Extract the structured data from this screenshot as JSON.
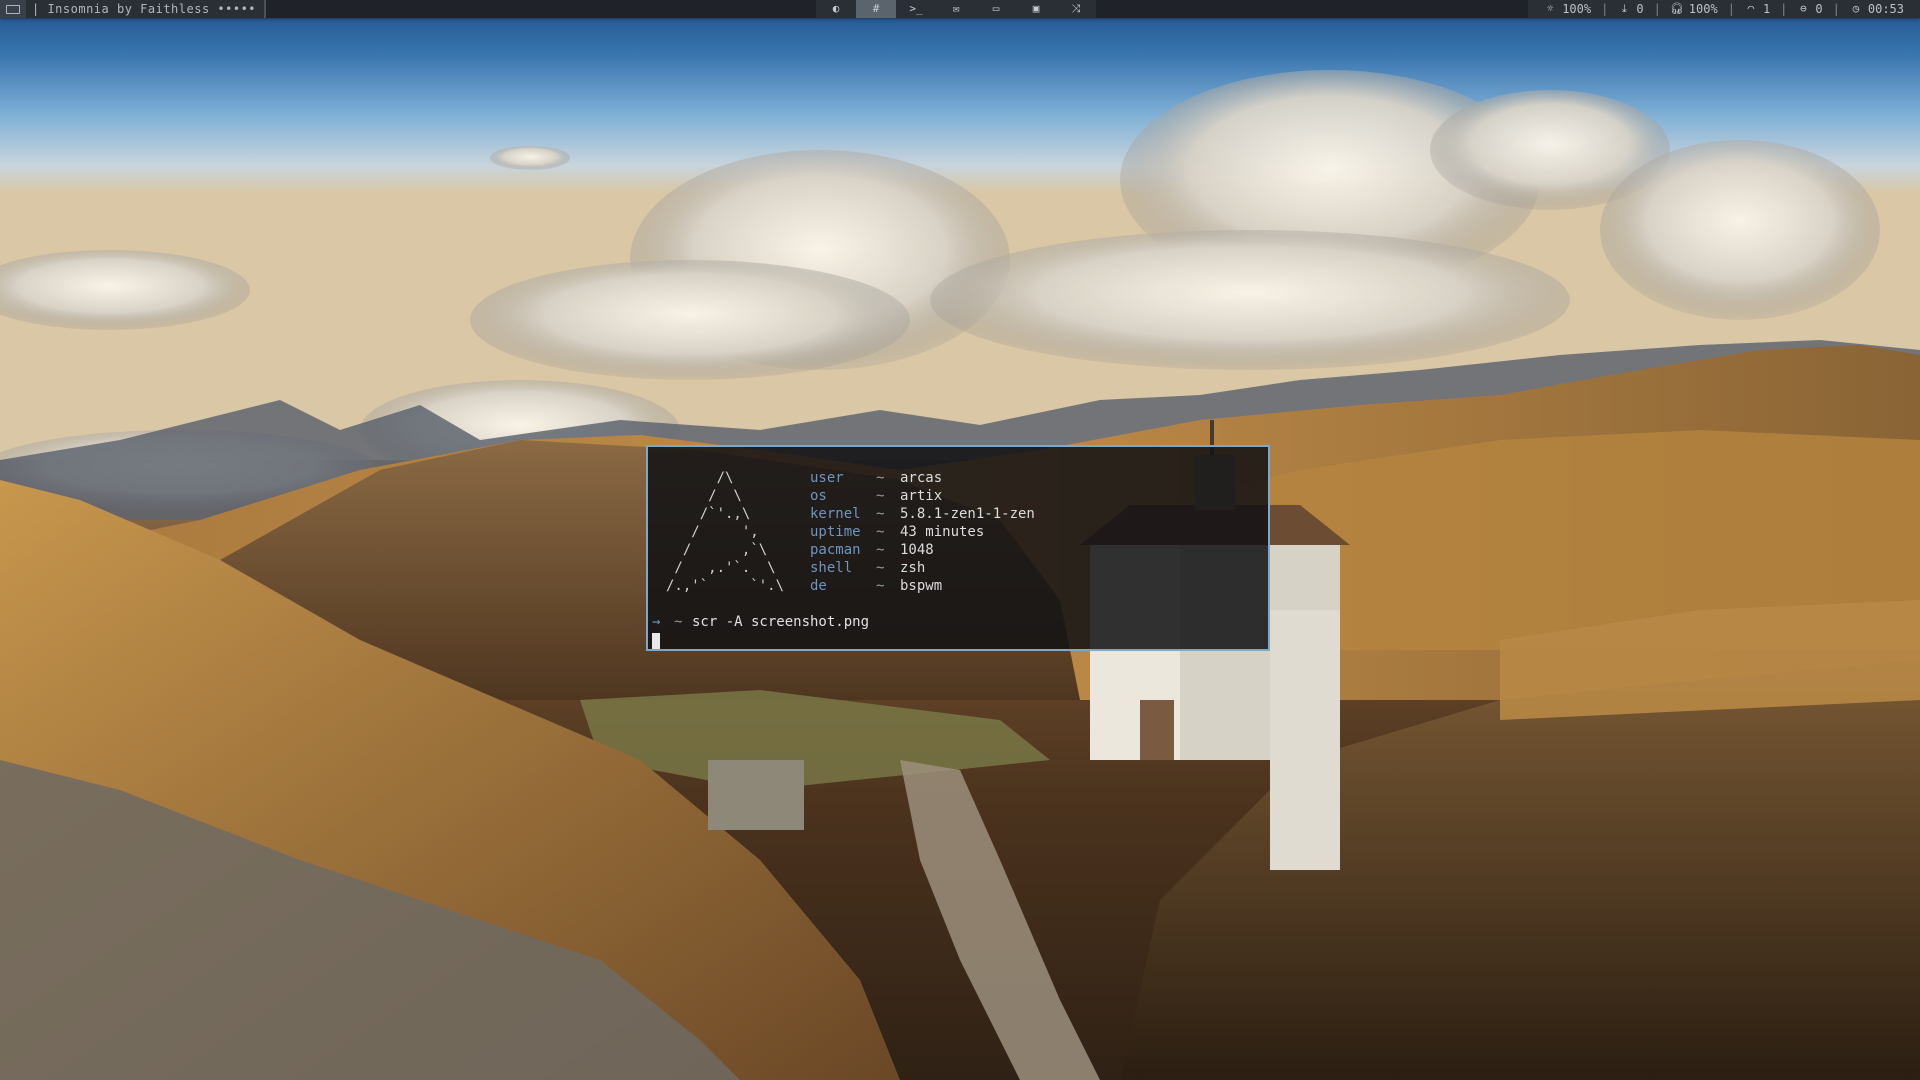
{
  "topbar": {
    "now_playing": "| Insomnia by Faithless •••••",
    "workspaces": [
      {
        "icon": "moon-icon",
        "glyph": "◐",
        "active": false
      },
      {
        "icon": "hash-icon",
        "glyph": "#",
        "active": true
      },
      {
        "icon": "terminal-icon",
        "glyph": ">_",
        "active": false
      },
      {
        "icon": "mail-icon",
        "glyph": "✉",
        "active": false
      },
      {
        "icon": "monitor-icon",
        "glyph": "▭",
        "active": false
      },
      {
        "icon": "window-icon",
        "glyph": "▣",
        "active": false
      },
      {
        "icon": "shuffle-icon",
        "glyph": "⤨",
        "active": false
      }
    ],
    "status": {
      "brightness": "100%",
      "downloads": "0",
      "volume": "100%",
      "wifi": "1",
      "updates": "0",
      "clock": "00:53"
    }
  },
  "terminal": {
    "ascii_art": "      /\\\n     /  \\\n    /`'.,\\\n   /     ',\n  /      ,`\\\n /   ,.'`.  \\\n/.,'`     `'.\\",
    "info": [
      {
        "key": "user",
        "sep": "~",
        "value": "arcas"
      },
      {
        "key": "os",
        "sep": "~",
        "value": "artix"
      },
      {
        "key": "kernel",
        "sep": "~",
        "value": "5.8.1-zen1-1-zen"
      },
      {
        "key": "uptime",
        "sep": "~",
        "value": "43 minutes"
      },
      {
        "key": "pacman",
        "sep": "~",
        "value": "1048"
      },
      {
        "key": "shell",
        "sep": "~",
        "value": "zsh"
      },
      {
        "key": "de",
        "sep": "~",
        "value": "bspwm"
      }
    ],
    "prompt": {
      "arrow": "→",
      "cwd": "~",
      "command": "scr -A screenshot.png"
    }
  },
  "colors": {
    "accent_blue": "#7ea8c8",
    "key_blue": "#6f95bf",
    "bar_bg": "#1f2329"
  }
}
